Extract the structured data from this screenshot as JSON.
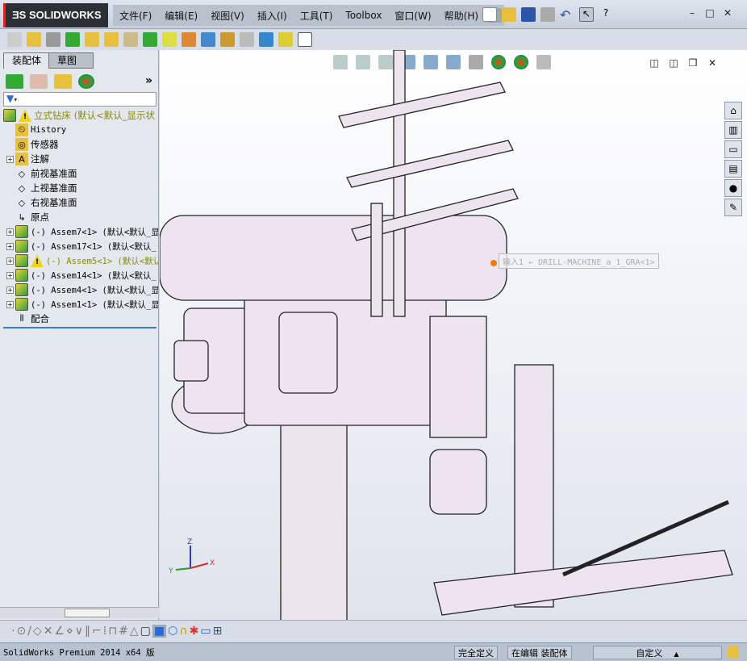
{
  "app": {
    "logo": "SOLIDWORKS",
    "brand_color": "#d42a2a"
  },
  "menu": [
    "文件(F)",
    "编辑(E)",
    "视图(V)",
    "插入(I)",
    "工具(T)",
    "Toolbox",
    "窗口(W)",
    "帮助(H)"
  ],
  "window_controls": {
    "restore": "❐",
    "minimize": "–",
    "maximize": "□",
    "close": "✕"
  },
  "panel": {
    "tabs": [
      "装配体",
      "草图"
    ],
    "active_tab": 0,
    "expand": "»"
  },
  "tree": {
    "root": "立式钻床  (默认<默认_显示状",
    "items": [
      {
        "label": "History",
        "icon": "history-folder-icon",
        "expandable": false,
        "mono": true
      },
      {
        "label": "传感器",
        "icon": "sensor-folder-icon",
        "expandable": false
      },
      {
        "label": "注解",
        "icon": "annotation-folder-icon",
        "expandable": true
      },
      {
        "label": "前视基准面",
        "icon": "plane-icon",
        "expandable": false
      },
      {
        "label": "上视基准面",
        "icon": "plane-icon",
        "expandable": false
      },
      {
        "label": "右视基准面",
        "icon": "plane-icon",
        "expandable": false
      },
      {
        "label": "原点",
        "icon": "origin-icon",
        "expandable": false
      },
      {
        "label": "(-) Assem7<1> (默认<默认_显",
        "icon": "assembly-icon",
        "expandable": true,
        "mono": true
      },
      {
        "label": "(-) Assem17<1> (默认<默认_",
        "icon": "assembly-icon",
        "expandable": true,
        "mono": true
      },
      {
        "label": "(-) Assem5<1> (默认<默认",
        "icon": "assembly-icon",
        "expandable": true,
        "mono": true,
        "warning": true
      },
      {
        "label": "(-) Assem14<1> (默认<默认_",
        "icon": "assembly-icon",
        "expandable": true,
        "mono": true
      },
      {
        "label": "(-) Assem4<1> (默认<默认_显",
        "icon": "assembly-icon",
        "expandable": true,
        "mono": true
      },
      {
        "label": "(-) Assem1<1> (默认<默认_显",
        "icon": "assembly-icon",
        "expandable": true,
        "mono": true
      },
      {
        "label": "配合",
        "icon": "mates-icon",
        "expandable": false
      }
    ],
    "warning_color": "#8a8a00"
  },
  "viewport": {
    "tooltip": "输入1 ← DRILL-MACHINE_a_1_GRA<1>",
    "triad": {
      "x": "X",
      "y": "Y",
      "z": "Z"
    }
  },
  "status": {
    "product": "SolidWorks Premium 2014 x64 版",
    "definition": "完全定义",
    "mode": "在编辑 装配体",
    "units": "自定义",
    "units_arrow": "▲"
  }
}
